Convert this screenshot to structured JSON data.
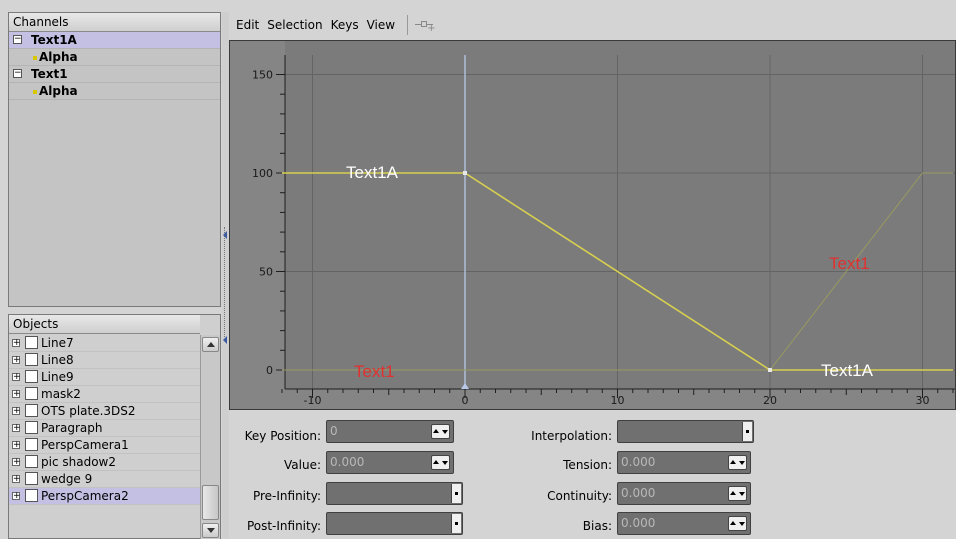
{
  "channels": {
    "header": "Channels",
    "rows": [
      {
        "label": "Text1A",
        "kind": "object",
        "expander": "−",
        "selected": true
      },
      {
        "label": "Alpha",
        "kind": "channel",
        "selected": false
      },
      {
        "label": "Text1",
        "kind": "object",
        "expander": "−",
        "selected": false
      },
      {
        "label": "Alpha",
        "kind": "channel",
        "selected": false
      }
    ]
  },
  "objects": {
    "header": "Objects",
    "items": [
      {
        "label": "Line7",
        "selected": false
      },
      {
        "label": "Line8",
        "selected": false
      },
      {
        "label": "Line9",
        "selected": false
      },
      {
        "label": "mask2",
        "selected": false
      },
      {
        "label": "OTS plate.3DS2",
        "selected": false
      },
      {
        "label": "Paragraph",
        "selected": false
      },
      {
        "label": "PerspCamera1",
        "selected": false
      },
      {
        "label": "pic shadow2",
        "selected": false
      },
      {
        "label": "wedge 9",
        "selected": false
      },
      {
        "label": "PerspCamera2",
        "selected": true
      }
    ],
    "expander": "+"
  },
  "menu": {
    "items": [
      "Edit",
      "Selection",
      "Keys",
      "View"
    ],
    "tool_icon": "key-tool-icon"
  },
  "graph": {
    "y_ticks": [
      "150",
      "100",
      "50",
      "0"
    ],
    "x_ticks": [
      "-10",
      "0",
      "10",
      "20",
      "30"
    ],
    "current_frame": 0,
    "colors": {
      "background": "#7b7b7b",
      "grid": "#646464",
      "curve_selected": "#d8d050",
      "curve_other": "#9a9a60",
      "frame_line": "#b8c8e8",
      "label_selected": "#ffffff",
      "label_other": "#e03030"
    },
    "labels": {
      "selected": "Text1A",
      "other": "Text1"
    }
  },
  "chart_data": {
    "type": "line",
    "xlim": [
      -12,
      32
    ],
    "ylim": [
      -8,
      155
    ],
    "series": [
      {
        "name": "Text1A",
        "x": [
          -12,
          0,
          20,
          32
        ],
        "y": [
          100,
          100,
          0,
          0
        ]
      },
      {
        "name": "Text1",
        "x": [
          -12,
          20,
          30,
          32
        ],
        "y": [
          0,
          0,
          100,
          100
        ]
      }
    ]
  },
  "properties": {
    "key_position": {
      "label": "Key Position:",
      "value": "0"
    },
    "value": {
      "label": "Value:",
      "value": "0.000"
    },
    "pre_infinity": {
      "label": "Pre-Infinity:",
      "value": ""
    },
    "post_infinity": {
      "label": "Post-Infinity:",
      "value": ""
    },
    "interpolation": {
      "label": "Interpolation:",
      "value": ""
    },
    "tension": {
      "label": "Tension:",
      "value": "0.000"
    },
    "continuity": {
      "label": "Continuity:",
      "value": "0.000"
    },
    "bias": {
      "label": "Bias:",
      "value": "0.000"
    }
  }
}
